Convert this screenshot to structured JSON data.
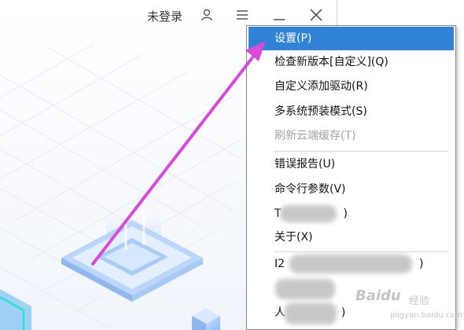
{
  "titlebar": {
    "login_label": "未登录",
    "icons": [
      "user-icon",
      "hamburger-menu-icon",
      "minimize-icon",
      "close-icon"
    ]
  },
  "menu": {
    "items": [
      {
        "label": "设置(P)",
        "state": "selected"
      },
      {
        "label": "检查新版本[自定义](Q)",
        "state": "normal"
      },
      {
        "label": "自定义添加驱动(R)",
        "state": "normal"
      },
      {
        "label": "多系统预装模式(S)",
        "state": "normal"
      },
      {
        "label": "刷新云端缓存(T)",
        "state": "disabled"
      },
      {
        "label": "错误报告(U)",
        "state": "normal"
      },
      {
        "label": "命令行参数(V)",
        "state": "normal"
      },
      {
        "label": "关于(X)",
        "state": "normal"
      }
    ],
    "partial_items": [
      {
        "visible_start": "T",
        "visible_end": ")"
      },
      {
        "visible_start": "I2",
        "visible_end": ")"
      },
      {
        "visible_start": "人",
        "visible_end": ")"
      }
    ]
  },
  "watermark": {
    "brand": "Baidu",
    "suffix": "经验",
    "url": "jingyan.baidu.com"
  },
  "colors": {
    "selected": "#2f82d6",
    "arrow": "#d64bd9",
    "disabled_text": "#a2a2a2"
  }
}
